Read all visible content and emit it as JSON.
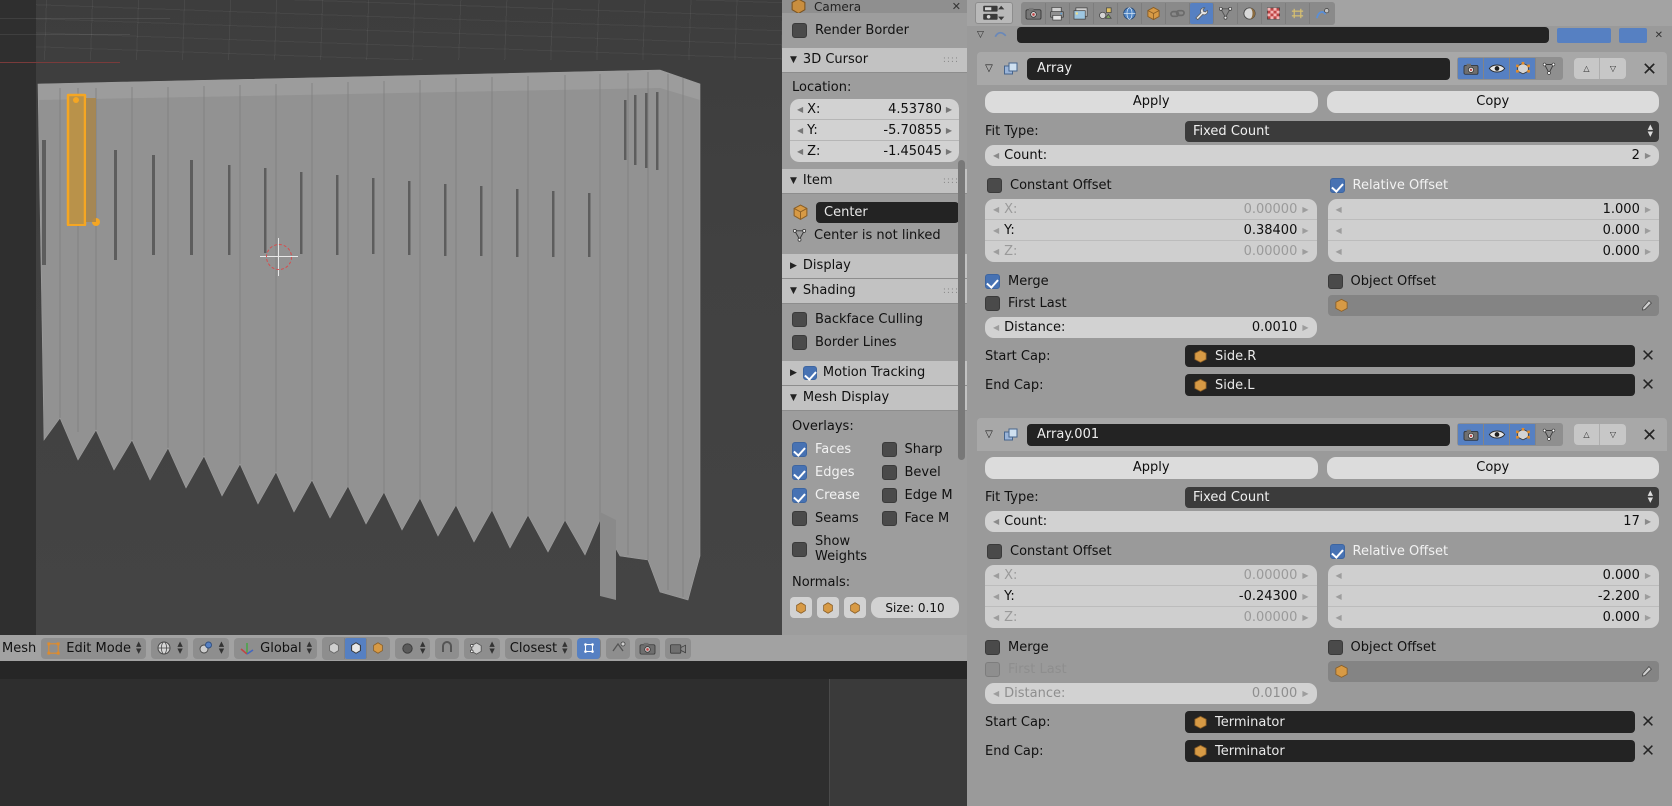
{
  "app": "Blender",
  "viewport": {
    "name": "3d-viewport",
    "mode_label": "Edit Mode",
    "orientation": "Global",
    "snap_label": "Closest",
    "mesh_label": "Mesh"
  },
  "npanel": {
    "camera_partial": "Camera",
    "render_border": "Render Border",
    "cursor": {
      "title": "3D Cursor",
      "location_label": "Location:",
      "fields": [
        {
          "name": "X:",
          "value": "4.53780"
        },
        {
          "name": "Y:",
          "value": "-5.70855"
        },
        {
          "name": "Z:",
          "value": "-1.45045"
        }
      ]
    },
    "item": {
      "title": "Item",
      "object_name": "Center",
      "link_text": "Center is not linked"
    },
    "display": {
      "title": "Display"
    },
    "shading": {
      "title": "Shading",
      "backface_culling": {
        "label": "Backface Culling",
        "checked": false
      },
      "border_lines": {
        "label": "Border Lines",
        "checked": false
      }
    },
    "motion_tracking": {
      "title": "Motion Tracking",
      "checked": true
    },
    "mesh_display": {
      "title": "Mesh Display",
      "overlays_label": "Overlays:",
      "left_column": [
        {
          "label": "Faces",
          "checked": true
        },
        {
          "label": "Edges",
          "checked": true
        },
        {
          "label": "Crease",
          "checked": true
        },
        {
          "label": "Seams",
          "checked": false
        },
        {
          "label": "Show Weights",
          "checked": false
        }
      ],
      "right_column": [
        {
          "label": "Sharp",
          "checked": false
        },
        {
          "label": "Bevel",
          "checked": false
        },
        {
          "label": "Edge M",
          "checked": false
        },
        {
          "label": "Face M",
          "checked": false
        }
      ],
      "normals_label": "Normals:",
      "normals_size": "Size: 0.10"
    }
  },
  "properties": {
    "tabs": [
      {
        "name": "render-tab",
        "icon": "camera-icon",
        "selected": false
      },
      {
        "name": "output-tab",
        "icon": "printer-icon",
        "selected": false
      },
      {
        "name": "view-layer-tab",
        "icon": "images-icon",
        "selected": false
      },
      {
        "name": "scene-tab",
        "icon": "scene-icon",
        "selected": false
      },
      {
        "name": "world-tab",
        "icon": "globe-icon",
        "selected": false
      },
      {
        "name": "object-tab",
        "icon": "cube-icon",
        "selected": false
      },
      {
        "name": "constraints-tab",
        "icon": "chain-icon",
        "selected": false
      },
      {
        "name": "modifiers-tab",
        "icon": "wrench-icon",
        "selected": true
      },
      {
        "name": "particles-tab",
        "icon": "particles-icon",
        "selected": false
      },
      {
        "name": "physics-tab",
        "icon": "physics-icon",
        "selected": false
      },
      {
        "name": "material-tab",
        "icon": "checker-icon",
        "selected": false
      },
      {
        "name": "data-tab",
        "icon": "mesh-data-icon",
        "selected": false
      },
      {
        "name": "texture-tab",
        "icon": "texture-icon",
        "selected": false
      }
    ],
    "modifiers": [
      {
        "name": "Array",
        "expanded": true,
        "apply_label": "Apply",
        "copy_label": "Copy",
        "fit_type_label": "Fit Type:",
        "fit_type_value": "Fixed Count",
        "count_label": "Count:",
        "count_value": "2",
        "constant_offset": {
          "label": "Constant Offset",
          "checked": false
        },
        "relative_offset": {
          "label": "Relative Offset",
          "checked": true
        },
        "constant_values": [
          {
            "axis": "X:",
            "value": "0.00000"
          },
          {
            "axis": "Y:",
            "value": "0.38400"
          },
          {
            "axis": "Z:",
            "value": "0.00000"
          }
        ],
        "relative_values": [
          {
            "axis": "",
            "value": "1.000"
          },
          {
            "axis": "",
            "value": "0.000"
          },
          {
            "axis": "",
            "value": "0.000"
          }
        ],
        "merge": {
          "label": "Merge",
          "checked": true
        },
        "first_last": {
          "label": "First Last",
          "checked": false,
          "dimmed": false
        },
        "distance_label": "Distance:",
        "distance_value": "0.0010",
        "object_offset": {
          "label": "Object Offset",
          "checked": false
        },
        "start_cap_label": "Start Cap:",
        "start_cap_value": "Side.R",
        "end_cap_label": "End Cap:",
        "end_cap_value": "Side.L",
        "toggles": [
          {
            "name": "render-toggle",
            "icon": "camera-icon",
            "on": true
          },
          {
            "name": "realtime-toggle",
            "icon": "eye-icon",
            "on": true
          },
          {
            "name": "edit-mode-toggle",
            "icon": "editmode-icon",
            "on": true
          },
          {
            "name": "on-cage-toggle",
            "icon": "cage-icon",
            "on": false
          }
        ]
      },
      {
        "name": "Array.001",
        "expanded": true,
        "apply_label": "Apply",
        "copy_label": "Copy",
        "fit_type_label": "Fit Type:",
        "fit_type_value": "Fixed Count",
        "count_label": "Count:",
        "count_value": "17",
        "constant_offset": {
          "label": "Constant Offset",
          "checked": false
        },
        "relative_offset": {
          "label": "Relative Offset",
          "checked": true
        },
        "constant_values": [
          {
            "axis": "X:",
            "value": "0.00000"
          },
          {
            "axis": "Y:",
            "value": "-0.24300"
          },
          {
            "axis": "Z:",
            "value": "0.00000"
          }
        ],
        "relative_values": [
          {
            "axis": "",
            "value": "0.000"
          },
          {
            "axis": "",
            "value": "-2.200"
          },
          {
            "axis": "",
            "value": "0.000"
          }
        ],
        "merge": {
          "label": "Merge",
          "checked": false
        },
        "first_last": {
          "label": "First Last",
          "checked": false,
          "dimmed": true
        },
        "distance_label": "Distance:",
        "distance_value": "0.0100",
        "object_offset": {
          "label": "Object Offset",
          "checked": false
        },
        "start_cap_label": "Start Cap:",
        "start_cap_value": "Terminator",
        "end_cap_label": "End Cap:",
        "end_cap_value": "Terminator",
        "toggles": [
          {
            "name": "render-toggle",
            "icon": "camera-icon",
            "on": true
          },
          {
            "name": "realtime-toggle",
            "icon": "eye-icon",
            "on": true
          },
          {
            "name": "edit-mode-toggle",
            "icon": "editmode-icon",
            "on": true
          },
          {
            "name": "on-cage-toggle",
            "icon": "cage-icon",
            "on": false
          }
        ]
      }
    ]
  },
  "colors": {
    "accent_blue": "#5680c2",
    "panel_gray": "#9a9a9a",
    "header_gray": "#a8a8a8",
    "field_dark": "#232323",
    "viewport_bg": "#3b3b3b",
    "mesh_gray": "#8f8f8f",
    "selected_orange": "#f5a623"
  }
}
